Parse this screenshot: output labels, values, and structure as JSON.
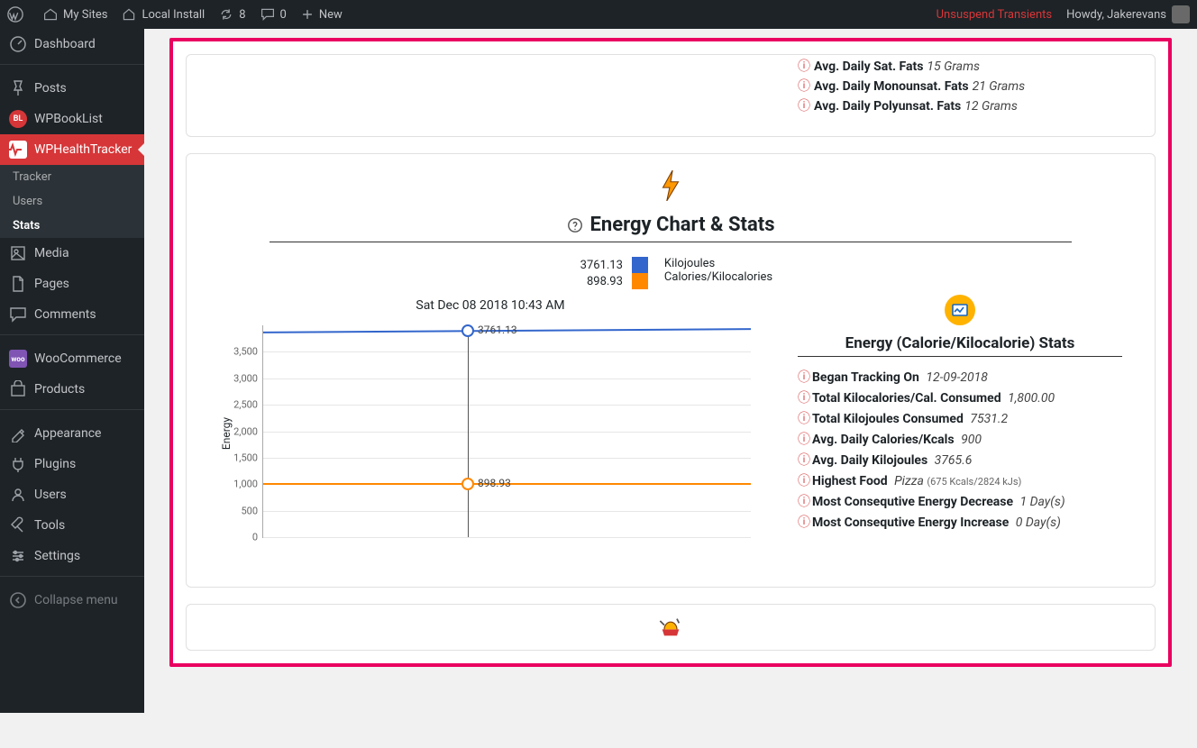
{
  "adminbar": {
    "my_sites": "My Sites",
    "site_name": "Local Install",
    "updates": "8",
    "comments": "0",
    "new": "New",
    "unsuspend": "Unsuspend Transients",
    "howdy": "Howdy, Jakerevans"
  },
  "sidebar": {
    "dashboard": "Dashboard",
    "posts": "Posts",
    "wpbooklist": "WPBookList",
    "wphealthtracker": "WPHealthTracker",
    "sub_tracker": "Tracker",
    "sub_users": "Users",
    "sub_stats": "Stats",
    "media": "Media",
    "pages": "Pages",
    "comments": "Comments",
    "woocommerce": "WooCommerce",
    "products": "Products",
    "appearance": "Appearance",
    "plugins": "Plugins",
    "users": "Users",
    "tools": "Tools",
    "settings": "Settings",
    "collapse": "Collapse menu"
  },
  "fats_card": {
    "items": [
      {
        "label": "Avg. Daily Sat. Fats",
        "value": "15 Grams"
      },
      {
        "label": "Avg. Daily Monounsat. Fats",
        "value": "21 Grams"
      },
      {
        "label": "Avg. Daily Polyunsat. Fats",
        "value": "12 Grams"
      }
    ]
  },
  "energy_card": {
    "title": "Energy Chart & Stats",
    "legend": {
      "kj_value": "3761.13",
      "kj_label": "Kilojoules",
      "kc_value": "898.93",
      "kc_label": "Calories/Kilocalories"
    },
    "timestamp": "Sat Dec 08 2018 10:43 AM",
    "ylabel": "Energy",
    "marker_kj": "3761.13",
    "marker_kc": "898.93",
    "stats_title": "Energy (Calorie/Kilocalorie) Stats",
    "stats": [
      {
        "label": "Began Tracking On",
        "value": "12-09-2018"
      },
      {
        "label": "Total Kilocalories/Cal. Consumed",
        "value": "1,800.00"
      },
      {
        "label": "Total Kilojoules Consumed",
        "value": "7531.2"
      },
      {
        "label": "Avg. Daily Calories/Kcals",
        "value": "900"
      },
      {
        "label": "Avg. Daily Kilojoules",
        "value": "3765.6"
      },
      {
        "label": "Highest Food",
        "value": "Pizza",
        "sub": "(675 Kcals/2824 kJs)"
      },
      {
        "label": "Most Consequtive Energy Decrease",
        "value": "1 Day(s)"
      },
      {
        "label": "Most Consequtive Energy Increase",
        "value": "0 Day(s)"
      }
    ]
  },
  "chart_data": {
    "type": "line",
    "title": "Energy Chart & Stats",
    "xlabel": "",
    "ylabel": "Energy",
    "ylim": [
      0,
      4000
    ],
    "yticks": [
      0,
      500,
      1000,
      1500,
      2000,
      2500,
      3000,
      3500
    ],
    "series": [
      {
        "name": "Kilojoules",
        "values": [
          3761.13,
          3770.0
        ],
        "color": "#3366cc"
      },
      {
        "name": "Calories/Kilocalories",
        "values": [
          898.93,
          901.0
        ],
        "color": "#ff8800"
      }
    ],
    "cursor": {
      "timestamp": "Sat Dec 08 2018 10:43 AM",
      "kj": 3761.13,
      "kc": 898.93
    }
  }
}
